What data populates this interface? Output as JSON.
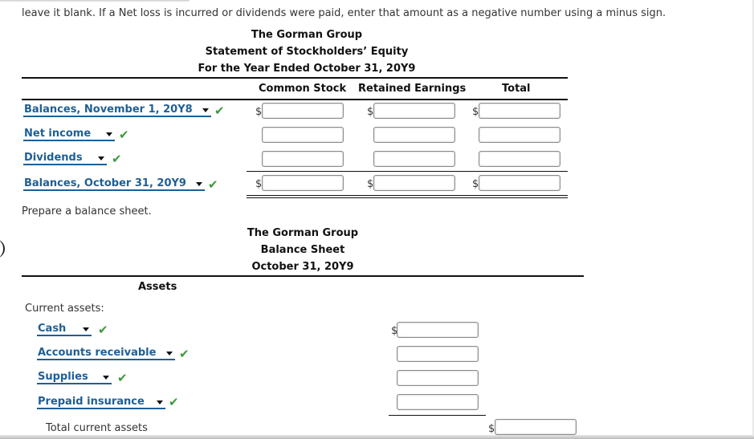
{
  "instructions": {
    "line": "leave it blank. If a Net loss is incurred or dividends were paid, enter that amount as a negative number using a minus sign.",
    "balance_sheet_prompt": "Prepare a balance sheet."
  },
  "equity_statement": {
    "company": "The Gorman Group",
    "title": "Statement of Stockholders’ Equity",
    "period": "For the Year Ended October 31, 20Y9",
    "columns": [
      "Common Stock",
      "Retained Earnings",
      "Total"
    ],
    "currency_symbol": "$",
    "rows": [
      {
        "label": "Balances, November 1, 20Y8",
        "status": "correct",
        "values": [
          "",
          "",
          ""
        ]
      },
      {
        "label": "Net income",
        "status": "correct",
        "values": [
          "",
          "",
          ""
        ]
      },
      {
        "label": "Dividends",
        "status": "correct",
        "values": [
          "",
          "",
          ""
        ]
      },
      {
        "label": "Balances, October 31, 20Y9",
        "status": "correct",
        "values": [
          "",
          "",
          ""
        ]
      }
    ]
  },
  "balance_sheet": {
    "company": "The Gorman Group",
    "title": "Balance Sheet",
    "date": "October 31, 20Y9",
    "assets_header": "Assets",
    "current_assets_label": "Current assets:",
    "currency_symbol": "$",
    "rows": [
      {
        "label": "Cash",
        "status": "correct",
        "value": ""
      },
      {
        "label": "Accounts receivable",
        "status": "correct",
        "value": ""
      },
      {
        "label": "Supplies",
        "status": "correct",
        "value": ""
      },
      {
        "label": "Prepaid insurance",
        "status": "correct",
        "value": ""
      }
    ],
    "total_current_assets_label": "Total current assets",
    "total_current_assets_value": ""
  },
  "icons": {
    "check": "✔",
    "dropdown": "chevron-down-icon"
  },
  "colors": {
    "select_text": "#1f5f94",
    "check": "#3a9a3a"
  }
}
